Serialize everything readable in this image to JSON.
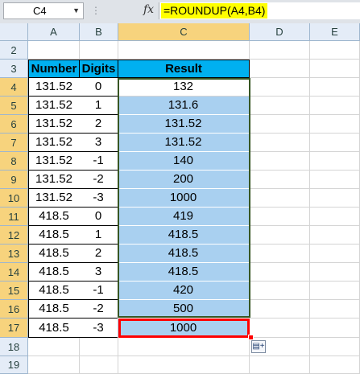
{
  "formula_bar": {
    "name_box": "C4",
    "fx_label": "fx",
    "formula": "=ROUNDUP(A4,B4)"
  },
  "columns": [
    "A",
    "B",
    "C",
    "D",
    "E"
  ],
  "rows": [
    "2",
    "3",
    "4",
    "5",
    "6",
    "7",
    "8",
    "9",
    "10",
    "11",
    "12",
    "13",
    "14",
    "15",
    "16",
    "17",
    "18",
    "19"
  ],
  "table": {
    "headers": [
      "Number",
      "Digits",
      "Result"
    ],
    "data": [
      [
        "131.52",
        "0",
        "132"
      ],
      [
        "131.52",
        "1",
        "131.6"
      ],
      [
        "131.52",
        "2",
        "131.52"
      ],
      [
        "131.52",
        "3",
        "131.52"
      ],
      [
        "131.52",
        "-1",
        "140"
      ],
      [
        "131.52",
        "-2",
        "200"
      ],
      [
        "131.52",
        "-3",
        "1000"
      ],
      [
        "418.5",
        "0",
        "419"
      ],
      [
        "418.5",
        "1",
        "418.5"
      ],
      [
        "418.5",
        "2",
        "418.5"
      ],
      [
        "418.5",
        "3",
        "418.5"
      ],
      [
        "418.5",
        "-1",
        "420"
      ],
      [
        "418.5",
        "-2",
        "500"
      ],
      [
        "418.5",
        "-3",
        "1000"
      ]
    ]
  },
  "colors": {
    "header_fill": "#00b0f0",
    "selection_fill": "#a9d0f0",
    "active_border": "#ff0000",
    "copy_border": "#375623",
    "formula_highlight": "#ffff00"
  },
  "icons": {
    "paste_options": "paste-options-icon",
    "dropdown": "chevron-down-icon"
  }
}
